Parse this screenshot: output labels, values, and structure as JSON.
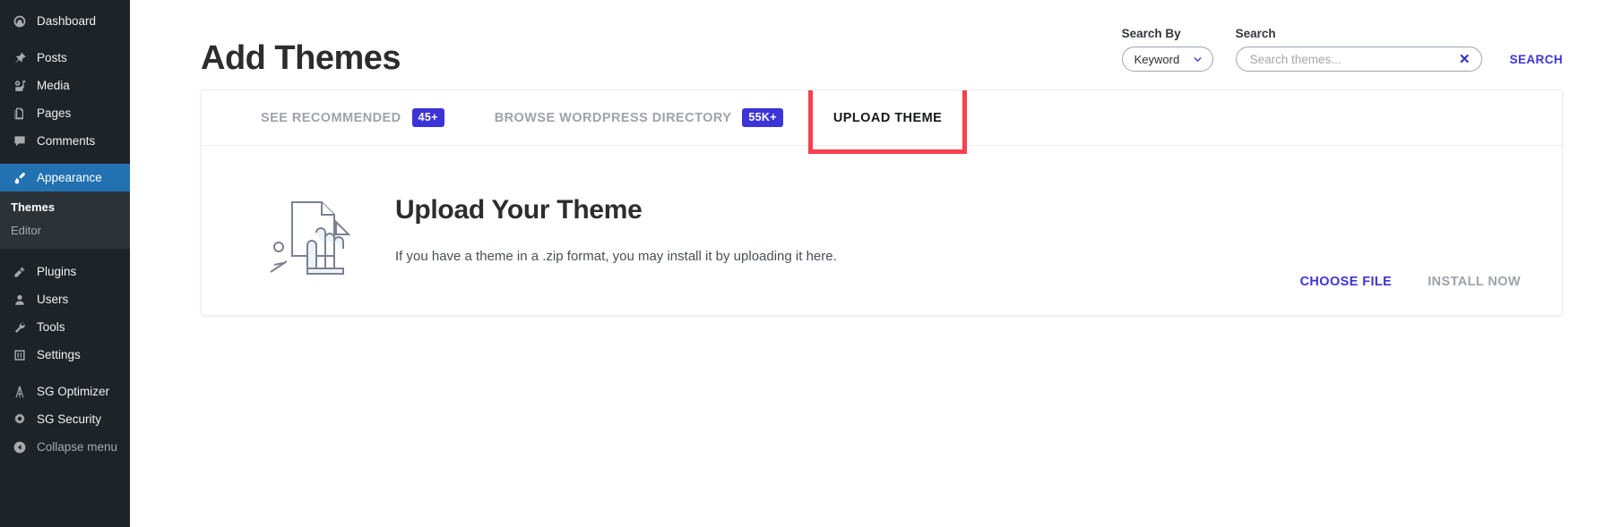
{
  "sidebar": {
    "items": [
      {
        "label": "Dashboard",
        "icon": "dashboard-icon",
        "active": false
      },
      {
        "label": "Posts",
        "icon": "pin-icon",
        "active": false
      },
      {
        "label": "Media",
        "icon": "media-icon",
        "active": false
      },
      {
        "label": "Pages",
        "icon": "pages-icon",
        "active": false
      },
      {
        "label": "Comments",
        "icon": "comments-icon",
        "active": false
      },
      {
        "label": "Appearance",
        "icon": "brush-icon",
        "active": true
      },
      {
        "label": "Plugins",
        "icon": "plug-icon",
        "active": false
      },
      {
        "label": "Users",
        "icon": "user-icon",
        "active": false
      },
      {
        "label": "Tools",
        "icon": "wrench-icon",
        "active": false
      },
      {
        "label": "Settings",
        "icon": "settings-icon",
        "active": false
      },
      {
        "label": "SG Optimizer",
        "icon": "sg-optimizer-icon",
        "active": false
      },
      {
        "label": "SG Security",
        "icon": "sg-security-icon",
        "active": false
      }
    ],
    "submenu": [
      {
        "label": "Themes",
        "current": true
      },
      {
        "label": "Editor",
        "current": false
      }
    ],
    "collapse_label": "Collapse menu"
  },
  "header": {
    "title": "Add Themes",
    "search_by_label": "Search By",
    "search_by_value": "Keyword",
    "search_label": "Search",
    "search_value": "",
    "search_placeholder": "Search themes...",
    "clear_icon": "✕",
    "search_button": "SEARCH"
  },
  "tabs": [
    {
      "label": "SEE RECOMMENDED",
      "badge": "45+",
      "active": false,
      "highlighted": false
    },
    {
      "label": "BROWSE WORDPRESS DIRECTORY",
      "badge": "55K+",
      "active": false,
      "highlighted": false
    },
    {
      "label": "UPLOAD THEME",
      "badge": "",
      "active": true,
      "highlighted": true
    }
  ],
  "upload_panel": {
    "heading": "Upload Your Theme",
    "description": "If you have a theme in a .zip format, you may install it by uploading it here.",
    "choose_file_label": "CHOOSE FILE",
    "install_now_label": "INSTALL NOW",
    "illustration": "document-hand-pointer-icon"
  },
  "colors": {
    "accent_purple": "#3d34d8",
    "highlight_red": "#f8414f",
    "sidebar_bg": "#1d2327",
    "sidebar_active": "#2271b1"
  }
}
